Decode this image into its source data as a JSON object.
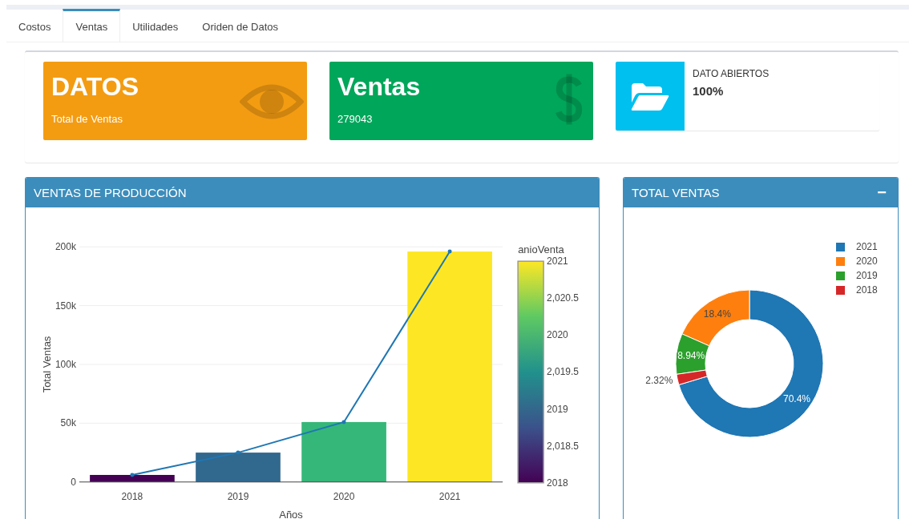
{
  "tabs": [
    {
      "label": "Costos",
      "selected": false
    },
    {
      "label": "Ventas",
      "selected": true
    },
    {
      "label": "Utilidades",
      "selected": false
    },
    {
      "label": "Oriden de Datos",
      "selected": false
    }
  ],
  "info_boxes": [
    {
      "kind": "solid",
      "color": "#f39c12",
      "title": "DATOS",
      "text": "Total de Ventas"
    },
    {
      "kind": "solid",
      "color": "#00a65a",
      "title": "Ventas",
      "text": "279043"
    },
    {
      "kind": "side",
      "color": "#00c0ef",
      "title": "DATO ABIERTOS",
      "text": "100%"
    }
  ],
  "panels": [
    {
      "title": "VENTAS DE PRODUCCIÓN",
      "chart_data": {
        "type": "bar",
        "xlabel": "Años",
        "ylabel": "Total Ventas",
        "categories": [
          "2018",
          "2019",
          "2020",
          "2021"
        ],
        "series": [
          {
            "type": "bar",
            "colors": [
              "#440154",
              "#31688e",
              "#35b779",
              "#fde725"
            ],
            "values": [
              6000,
              25000,
              51000,
              196000
            ]
          },
          {
            "type": "line",
            "color": "#1f77b4",
            "values": [
              6000,
              25000,
              51000,
              196000
            ]
          }
        ],
        "ylim": [
          0,
          200000
        ],
        "grid": true,
        "yticks": [
          {
            "value": 0,
            "label": "0"
          },
          {
            "value": 50000,
            "label": "50k"
          },
          {
            "value": 100000,
            "label": "100k"
          },
          {
            "value": 150000,
            "label": "150k"
          },
          {
            "value": 200000,
            "label": "200k"
          }
        ]
      },
      "colorbar": {
        "title": "anioVenta",
        "ticks": [
          "2021",
          "2,020.5",
          "2020",
          "2,019.5",
          "2019",
          "2,018.5",
          "2018"
        ]
      }
    },
    {
      "title": "TOTAL VENTAS",
      "collapse_label": "−",
      "chart_data": {
        "type": "donut",
        "categories": [
          "2021",
          "2020",
          "2019",
          "2018"
        ],
        "values": [
          70.4,
          18.4,
          8.94,
          2.32
        ],
        "colors": [
          "#1f77b4",
          "#ff7f0e",
          "#2ca02c",
          "#d62728"
        ],
        "value_labels": [
          "70.4%",
          "18.4%",
          "8.94%",
          "2.32%"
        ],
        "legend": "top-right"
      }
    }
  ]
}
